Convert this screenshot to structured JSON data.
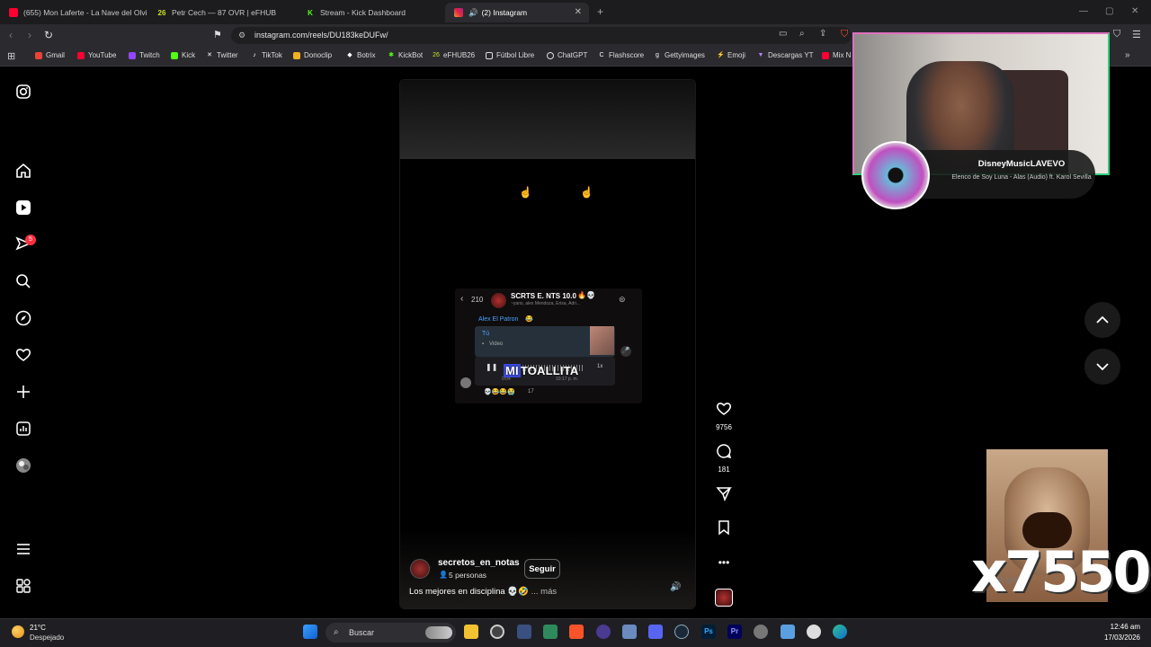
{
  "browser": {
    "tabs": [
      {
        "label": "(655) Mon Laferte - La Nave del Olvi",
        "icon": "youtube-icon",
        "color": "#ff0033"
      },
      {
        "label": "Petr Cech — 87 OVR | eFHUB",
        "icon": "efhub-icon",
        "color": "#c8e020"
      },
      {
        "label": "Stream - Kick Dashboard",
        "icon": "kick-icon",
        "color": "#53fc18"
      },
      {
        "label": "(2) Instagram",
        "icon": "instagram-icon",
        "color": "#e1306c",
        "active": true
      }
    ],
    "url": "instagram.com/reels/DU183keDUFw/",
    "bookmarks": [
      {
        "label": "Gmail",
        "color": "#ea4335"
      },
      {
        "label": "YouTube",
        "color": "#ff0033"
      },
      {
        "label": "Twitch",
        "color": "#9146ff"
      },
      {
        "label": "Kick",
        "color": "#53fc18"
      },
      {
        "label": "Twitter",
        "color": "#ffffff"
      },
      {
        "label": "TikTok",
        "color": "#ffffff"
      },
      {
        "label": "Donoclip",
        "color": "#f0b020"
      },
      {
        "label": "Botrix",
        "color": "#ffffff"
      },
      {
        "label": "KickBot",
        "color": "#53fc18"
      },
      {
        "label": "eFHUB26",
        "color": "#c8e020"
      },
      {
        "label": "Fútbol Libre",
        "color": "#ffffff"
      },
      {
        "label": "ChatGPT",
        "color": "#ffffff"
      },
      {
        "label": "Flashscore",
        "color": "#ffffff"
      },
      {
        "label": "Gettyimages",
        "color": "#ffffff"
      },
      {
        "label": "Emoji",
        "color": "#ff4070"
      },
      {
        "label": "Descargas YT",
        "color": "#c080ff"
      },
      {
        "label": "Mix N",
        "color": "#ff0033"
      }
    ]
  },
  "instagram": {
    "notification_count": "5",
    "reel": {
      "chat_title": "SCRTS E. NTS 10.0",
      "chat_members": "~yans, alex Mendoza, Erisa, Adri...",
      "chat_back_count": "210",
      "sender": "Alex El Patron",
      "reply_to": "Tú",
      "reply_type": "Video",
      "voice_duration": "0:04",
      "voice_time": "10:17 p. m.",
      "speed": "1x",
      "reaction_count": "17",
      "subtitle_highlight": "MI",
      "subtitle_rest": "TOALLITA"
    },
    "likes": "9756",
    "comments": "181",
    "username": "secretos_en_notas",
    "people": "5 personas",
    "follow_label": "Seguir",
    "caption": "Los mejores en disciplina 💀🤣",
    "more_label": "... más"
  },
  "overlay": {
    "artist": "DisneyMusicLAVEVO",
    "track": "Elenco de Soy Luna - Alas (Audio) ft. Karol Sevilla",
    "multiplier": "x7550",
    "faded_label": "Me gusta"
  },
  "taskbar": {
    "temperature": "21°C",
    "weather": "Despejado",
    "search_placeholder": "Buscar",
    "time": "12:46 am",
    "date": "17/03/2026"
  }
}
